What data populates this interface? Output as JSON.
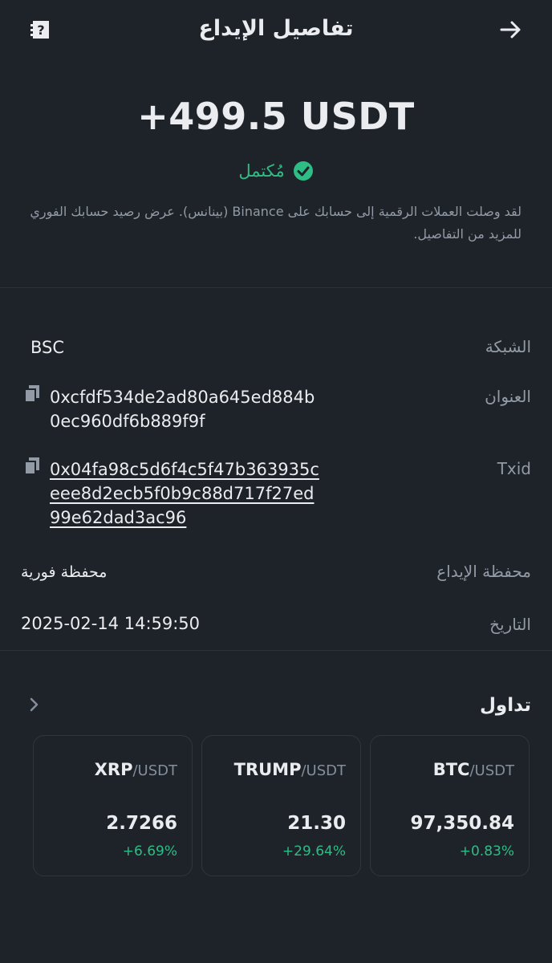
{
  "header": {
    "title": "تفاصيل الإيداع"
  },
  "deposit": {
    "amount": "+499.5 USDT",
    "status": "مُكتمل",
    "description": "لقد وصلت العملات الرقمية إلى حسابك على Binance (بينانس). عرض رصيد حسابك الفوري للمزيد من التفاصيل."
  },
  "details": {
    "network_label": "الشبكة",
    "network_value": "BSC",
    "address_label": "العنوان",
    "address_line1": "0xcfdf534de2ad80a645ed884b",
    "address_line2": "0ec960df6b889f9f",
    "txid_label": "Txid",
    "txid_line1": "0x04fa98c5d6f4c5f47b363935c",
    "txid_line2": "eee8d2ecb5f0b9c88d717f27ed",
    "txid_line3": "99e62dad3ac96",
    "wallet_label": "محفظة الإيداع",
    "wallet_value": "محفظة فورية",
    "date_label": "التاريخ",
    "date_value": "2025-02-14 14:59:50"
  },
  "trade": {
    "title": "تداول",
    "cards": [
      {
        "base": "BTC",
        "quote": "/USDT",
        "price": "97,350.84",
        "change": "+0.83%"
      },
      {
        "base": "TRUMP",
        "quote": "/USDT",
        "price": "21.30",
        "change": "+29.64%"
      },
      {
        "base": "XRP",
        "quote": "/USDT",
        "price": "2.7266",
        "change": "+6.69%"
      }
    ]
  },
  "colors": {
    "background": "#1e2329",
    "success": "#2ebd85",
    "text_primary": "#eaecef",
    "text_secondary": "#929aa5"
  },
  "icons": {
    "back": "arrow-right-icon",
    "help": "help-document-icon",
    "status": "check-circle-icon",
    "copy": "copy-icon",
    "more": "chevron-right-icon"
  }
}
